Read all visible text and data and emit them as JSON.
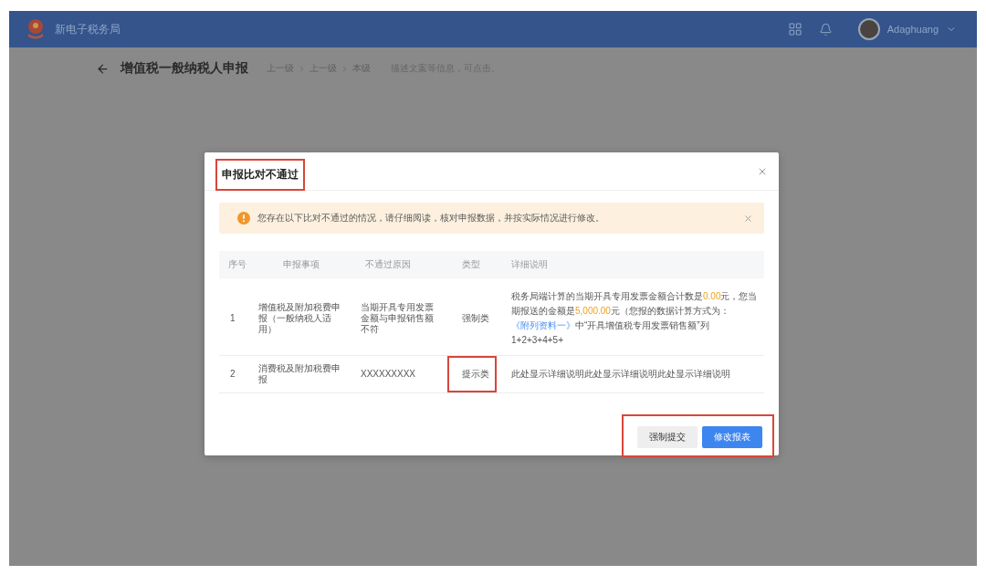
{
  "header": {
    "brand": "新电子税务局",
    "username": "Adaghuang"
  },
  "page": {
    "title": "增值税一般纳税人申报",
    "breadcrumb": [
      "上一级",
      "上一级",
      "本级"
    ],
    "note": "描述文案等信息，可点击。"
  },
  "dialog": {
    "title": "申报比对不通过",
    "title_highlighted": true,
    "alert": {
      "text": "您存在以下比对不通过的情况，请仔细阅读，核对申报数据，并按实际情况进行修改。"
    },
    "table": {
      "columns": [
        "序号",
        "申报事项",
        "不通过原因",
        "类型",
        "详细说明"
      ],
      "rows": [
        {
          "index": "1",
          "item": "增值税及附加税费申报（一般纳税人适用）",
          "reason": "当期开具专用发票金额与申报销售额不符",
          "type": "强制类",
          "type_highlighted": false,
          "details": [
            {
              "kind": "text",
              "text": "税务局端计算的当期开具专用发票金额合计数是"
            },
            {
              "kind": "amount",
              "text": "0.00"
            },
            {
              "kind": "text",
              "text": "元，您当期报送的金额是"
            },
            {
              "kind": "amount",
              "text": "5,000.00"
            },
            {
              "kind": "text",
              "text": "元（您报的数据计算方式为："
            },
            {
              "kind": "link",
              "text": "《附列资料一》"
            },
            {
              "kind": "text",
              "text": "中“开具增值税专用发票销售额”列1+2+3+4+5+"
            }
          ]
        },
        {
          "index": "2",
          "item": "消费税及附加税费申报",
          "reason": "XXXXXXXXX",
          "type": "提示类",
          "type_highlighted": true,
          "details": [
            {
              "kind": "text",
              "text": "此处显示详细说明此处显示详细说明此处显示详细说明"
            }
          ]
        }
      ]
    },
    "footer": {
      "highlighted": true,
      "buttons": [
        {
          "label": "强制提交",
          "kind": "secondary"
        },
        {
          "label": "修改报表",
          "kind": "primary"
        }
      ]
    }
  }
}
